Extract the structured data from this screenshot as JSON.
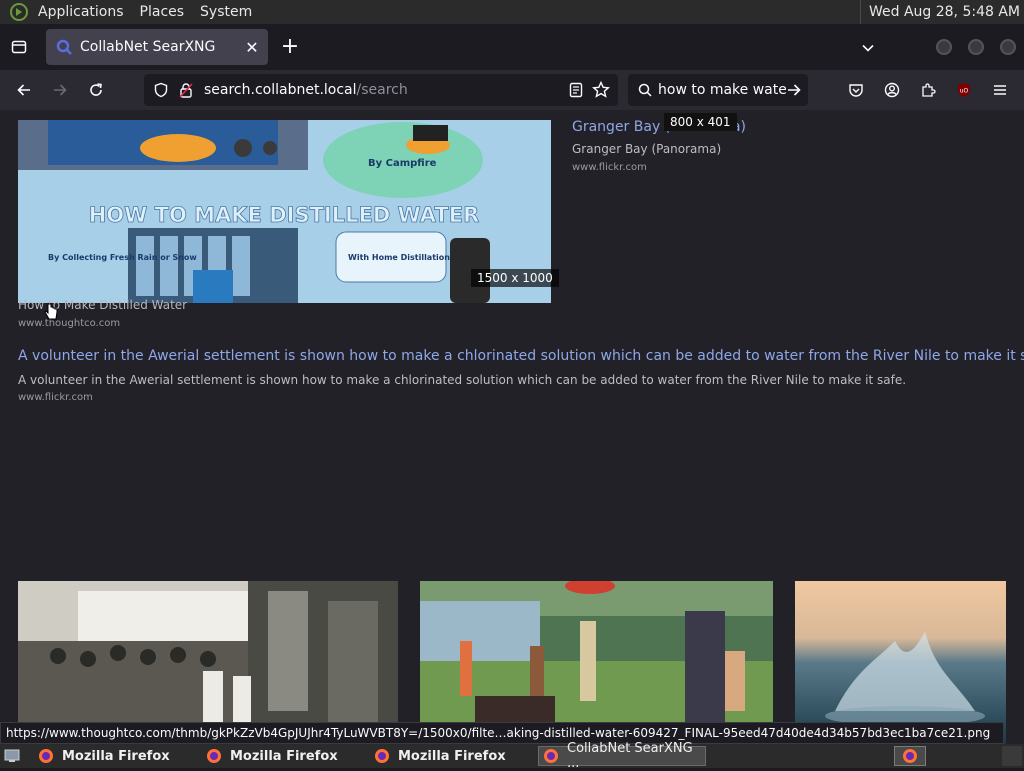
{
  "panel": {
    "menus": [
      "Applications",
      "Places",
      "System"
    ],
    "clock": "Wed Aug 28,  5:48 AM"
  },
  "browser": {
    "tab_title": "CollabNet SearXNG",
    "url_host": "search.collabnet.local",
    "url_path": "/search",
    "search_text": "how to make water"
  },
  "results": {
    "hero": {
      "resolution": "1500 x 1000",
      "title": "How to Make Distilled Water",
      "source": "www.thoughtco.com",
      "image_text": "HOW TO MAKE DISTILLED WATER",
      "label_campfire": "By Campfire",
      "label_rain": "By Collecting Fresh Rain or Snow",
      "label_kits": "With Home Distillation Kits"
    },
    "granger": {
      "title": "Granger Bay (Panorama)",
      "description": "Granger Bay (Panorama)",
      "source": "www.flickr.com",
      "tooltip": "800 x 401"
    },
    "volunteer": {
      "title": "A volunteer in the Awerial settlement is shown how to make a chlorinated solution which can be added to water from the River Nile to make it safe.",
      "description": "A volunteer in the Awerial settlement is shown how to make a chlorinated solution which can be added to water from the River Nile to make it safe.",
      "source": "www.flickr.com"
    }
  },
  "status_url": "https://www.thoughtco.com/thmb/gkPkZzVb4GpJUJhr4TyLuWVBT8Y=/1500x0/filte…aking-distilled-water-609427_FINAL-95eed47d40de4d34b57bd3ec1ba7ce21.png",
  "taskbar": {
    "items": [
      "Mozilla Firefox",
      "Mozilla Firefox",
      "Mozilla Firefox",
      "CollabNet SearXNG ..."
    ]
  },
  "colors": {
    "link": "#8ea7e8",
    "background": "#222128",
    "toolbar": "#2b2a33"
  }
}
